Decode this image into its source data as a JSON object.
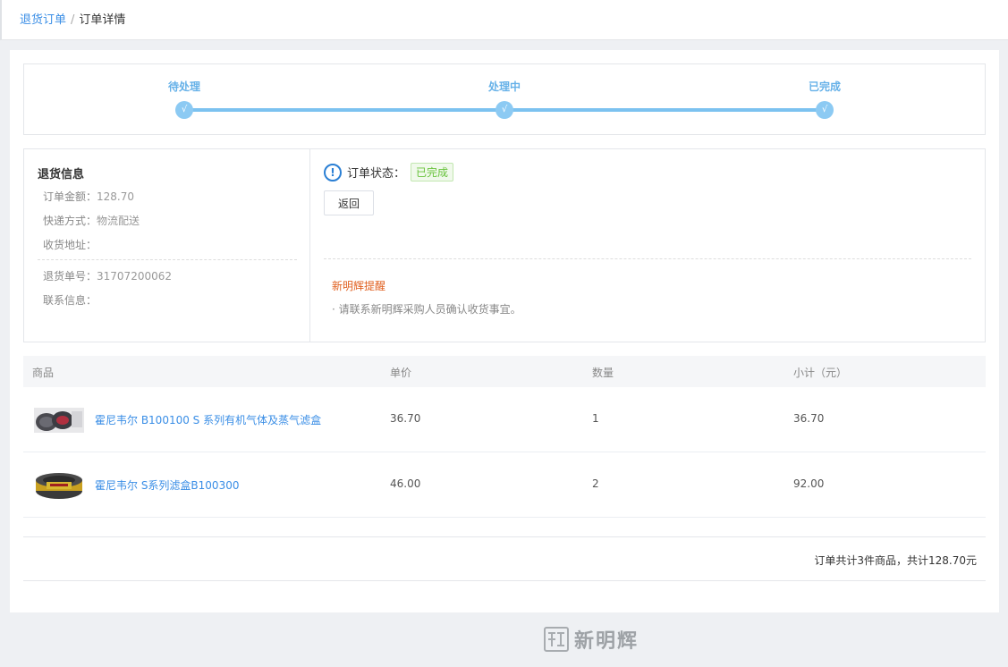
{
  "breadcrumb": {
    "parent": "退货订单",
    "separator": "/",
    "current": "订单详情"
  },
  "steps": [
    {
      "label": "待处理",
      "check": "√"
    },
    {
      "label": "处理中",
      "check": "√"
    },
    {
      "label": "已完成",
      "check": "√"
    }
  ],
  "return_info": {
    "title": "退货信息",
    "amount_label": "订单金额：",
    "amount": "128.70",
    "shipping_label": "快递方式：",
    "shipping": "物流配送",
    "address_label": "收货地址：",
    "address": "",
    "return_no_label": "退货单号：",
    "return_no": "31707200062",
    "contact_label": "联系信息：",
    "contact": ""
  },
  "status": {
    "icon": "!",
    "label": "订单状态：",
    "value": "已完成",
    "back_button": "返回",
    "tip_title": "新明辉提醒",
    "tip_text": "· 请联系新明辉采购人员确认收货事宜。"
  },
  "table": {
    "headers": {
      "product": "商品",
      "price": "单价",
      "qty": "数量",
      "subtotal": "小计（元）"
    },
    "rows": [
      {
        "name": "霍尼韦尔 B100100 S 系列有机气体及蒸气滤盒",
        "price": "36.70",
        "qty": "1",
        "subtotal": "36.70"
      },
      {
        "name": "霍尼韦尔 S系列滤盒B100300",
        "price": "46.00",
        "qty": "2",
        "subtotal": "92.00"
      }
    ]
  },
  "summary": "订单共计3件商品，共计128.70元",
  "footer": {
    "logo_text": "新明辉",
    "logo_icon": "brand-logo-icon"
  },
  "colors": {
    "accent": "#3a8ee6",
    "step": "#7cc2f0",
    "success": "#67c23a",
    "warning": "#e06020"
  }
}
